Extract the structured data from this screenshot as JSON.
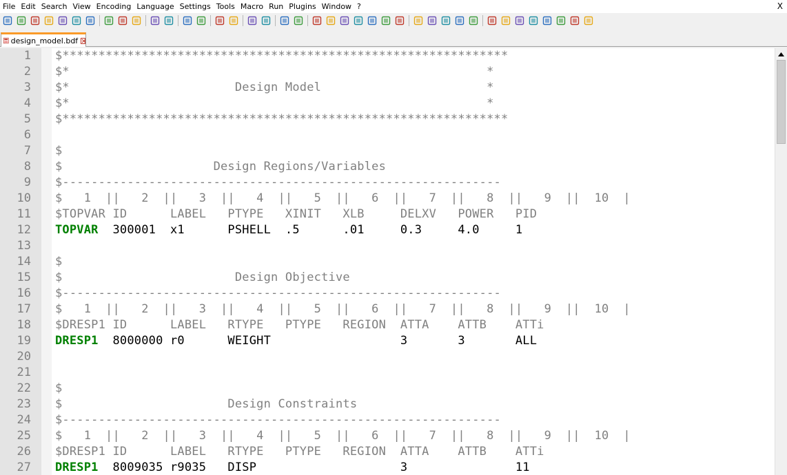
{
  "menu": [
    "File",
    "Edit",
    "Search",
    "View",
    "Encoding",
    "Language",
    "Settings",
    "Tools",
    "Macro",
    "Run",
    "Plugins",
    "Window",
    "?"
  ],
  "menu_close": "X",
  "toolbar_icons": [
    [
      "new-file-icon",
      "open-file-icon",
      "save-icon",
      "save-all-icon",
      "close-icon",
      "close-all-icon",
      "print-icon"
    ],
    [
      "cut-icon",
      "copy-icon",
      "paste-icon"
    ],
    [
      "undo-icon",
      "redo-icon"
    ],
    [
      "find-icon",
      "replace-icon"
    ],
    [
      "zoom-in-icon",
      "zoom-out-icon"
    ],
    [
      "sync-vertical-icon",
      "sync-horizontal-icon"
    ],
    [
      "word-wrap-icon",
      "show-all-chars-icon"
    ],
    [
      "indent-guide-icon",
      "udl-icon",
      "doc-map-icon",
      "function-list-icon",
      "folder-workspace-icon",
      "monitor-icon",
      "panel-icon"
    ],
    [
      "record-macro-icon",
      "stop-record-icon",
      "playback-icon",
      "run-multiple-icon",
      "save-macro-icon"
    ],
    [
      "spellcheck-icon",
      "compare-icon",
      "compare-clear-icon",
      "first-diff-icon",
      "prev-diff-icon",
      "next-diff-icon",
      "last-diff-icon",
      "nav-bar-icon"
    ]
  ],
  "tab": {
    "label": "design_model.bdf"
  },
  "lines": [
    {
      "n": "1",
      "segs": [
        {
          "c": "comment",
          "t": "$**************************************************************"
        }
      ]
    },
    {
      "n": "2",
      "segs": [
        {
          "c": "comment",
          "t": "$*                                                          *"
        }
      ]
    },
    {
      "n": "3",
      "segs": [
        {
          "c": "comment",
          "t": "$*                       Design Model                       *"
        }
      ]
    },
    {
      "n": "4",
      "segs": [
        {
          "c": "comment",
          "t": "$*                                                          *"
        }
      ]
    },
    {
      "n": "5",
      "segs": [
        {
          "c": "comment",
          "t": "$**************************************************************"
        }
      ]
    },
    {
      "n": "6",
      "segs": []
    },
    {
      "n": "7",
      "segs": [
        {
          "c": "comment",
          "t": "$"
        }
      ]
    },
    {
      "n": "8",
      "segs": [
        {
          "c": "comment",
          "t": "$                     Design Regions/Variables"
        }
      ]
    },
    {
      "n": "9",
      "segs": [
        {
          "c": "comment",
          "t": "$-------------------------------------------------------------"
        }
      ]
    },
    {
      "n": "10",
      "segs": [
        {
          "c": "comment",
          "t": "$   1  ||   2  ||   3  ||   4  ||   5  ||   6  ||   7  ||   8  ||   9  ||  10  |"
        }
      ]
    },
    {
      "n": "11",
      "segs": [
        {
          "c": "comment",
          "t": "$TOPVAR ID      LABEL   PTYPE   XINIT   XLB     DELXV   POWER   PID"
        }
      ]
    },
    {
      "n": "12",
      "segs": [
        {
          "c": "kw",
          "t": "TOPVAR"
        },
        {
          "c": "normal",
          "t": "  300001  x1      PSHELL  .5      .01     0.3     4.0     1"
        }
      ]
    },
    {
      "n": "13",
      "segs": []
    },
    {
      "n": "14",
      "segs": [
        {
          "c": "comment",
          "t": "$"
        }
      ]
    },
    {
      "n": "15",
      "segs": [
        {
          "c": "comment",
          "t": "$                        Design Objective"
        }
      ]
    },
    {
      "n": "16",
      "segs": [
        {
          "c": "comment",
          "t": "$-------------------------------------------------------------"
        }
      ]
    },
    {
      "n": "17",
      "segs": [
        {
          "c": "comment",
          "t": "$   1  ||   2  ||   3  ||   4  ||   5  ||   6  ||   7  ||   8  ||   9  ||  10  |"
        }
      ]
    },
    {
      "n": "18",
      "segs": [
        {
          "c": "comment",
          "t": "$DRESP1 ID      LABEL   RTYPE   PTYPE   REGION  ATTA    ATTB    ATTi"
        }
      ]
    },
    {
      "n": "19",
      "segs": [
        {
          "c": "kw",
          "t": "DRESP1"
        },
        {
          "c": "normal",
          "t": "  8000000 r0      WEIGHT                  3       3       ALL"
        }
      ]
    },
    {
      "n": "20",
      "segs": []
    },
    {
      "n": "21",
      "segs": []
    },
    {
      "n": "22",
      "segs": [
        {
          "c": "comment",
          "t": "$"
        }
      ]
    },
    {
      "n": "23",
      "segs": [
        {
          "c": "comment",
          "t": "$                       Design Constraints"
        }
      ]
    },
    {
      "n": "24",
      "segs": [
        {
          "c": "comment",
          "t": "$-------------------------------------------------------------"
        }
      ]
    },
    {
      "n": "25",
      "segs": [
        {
          "c": "comment",
          "t": "$   1  ||   2  ||   3  ||   4  ||   5  ||   6  ||   7  ||   8  ||   9  ||  10  |"
        }
      ]
    },
    {
      "n": "26",
      "segs": [
        {
          "c": "comment",
          "t": "$DRESP1 ID      LABEL   RTYPE   PTYPE   REGION  ATTA    ATTB    ATTi"
        }
      ]
    },
    {
      "n": "27",
      "segs": [
        {
          "c": "kw",
          "t": "DRESP1"
        },
        {
          "c": "normal",
          "t": "  8009035 r9035   DISP                    3               11"
        }
      ]
    }
  ],
  "colors": {
    "keyword": "#008000",
    "comment": "#808080",
    "gutter": "#e4e4e4",
    "tab_accent": "#fa9a28"
  }
}
